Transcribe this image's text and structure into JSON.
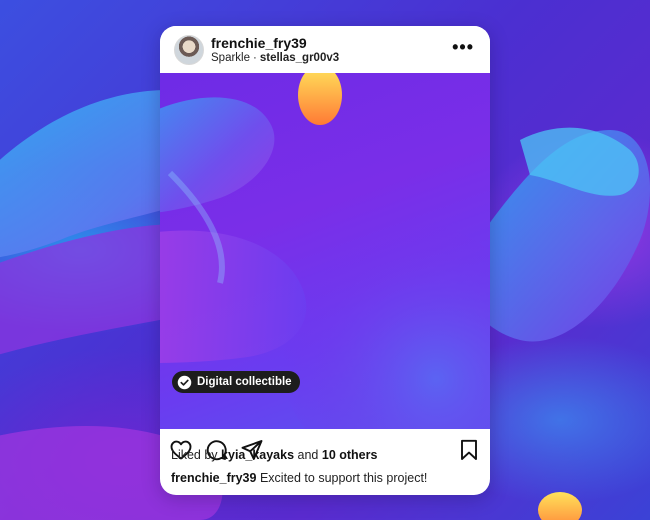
{
  "post": {
    "username": "frenchie_fry39",
    "subtitle_left": "Sparkle",
    "subtitle_separator": "·",
    "subtitle_collaborator": "stellas_gr00v3",
    "more_label": "•••"
  },
  "badge": {
    "label": "Digital collectible"
  },
  "likes": {
    "prefix": "Liked by",
    "user": "kyia_kayaks",
    "connector": "and",
    "others": "10 others"
  },
  "caption": {
    "user": "frenchie_fry39",
    "text": "Excited to support this project!"
  },
  "icons": {
    "like": "heart-icon",
    "comment": "comment-icon",
    "share": "send-icon",
    "save": "bookmark-icon",
    "badge": "verified-check-icon"
  },
  "colors": {
    "background_primary": "#3b3ad0",
    "media_purple": "#7a2ee8",
    "badge_bg": "#1d1d1d",
    "text_primary": "#111111"
  }
}
